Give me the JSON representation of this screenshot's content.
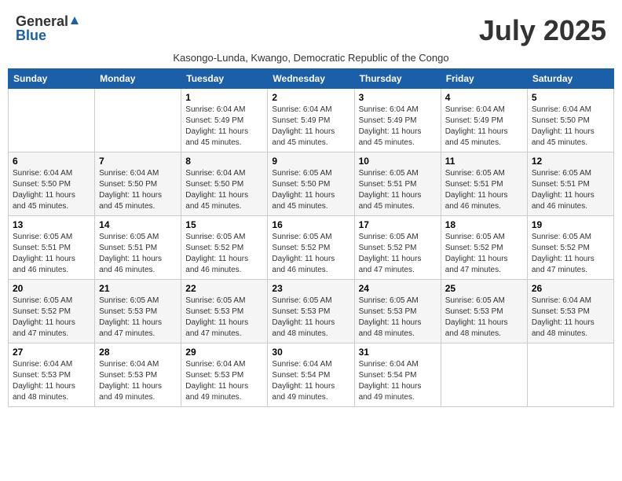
{
  "header": {
    "logo_general": "General",
    "logo_blue": "Blue",
    "month_title": "July 2025",
    "subtitle": "Kasongo-Lunda, Kwango, Democratic Republic of the Congo"
  },
  "days_of_week": [
    "Sunday",
    "Monday",
    "Tuesday",
    "Wednesday",
    "Thursday",
    "Friday",
    "Saturday"
  ],
  "weeks": [
    [
      {
        "day": "",
        "info": ""
      },
      {
        "day": "",
        "info": ""
      },
      {
        "day": "1",
        "info": "Sunrise: 6:04 AM\nSunset: 5:49 PM\nDaylight: 11 hours and 45 minutes."
      },
      {
        "day": "2",
        "info": "Sunrise: 6:04 AM\nSunset: 5:49 PM\nDaylight: 11 hours and 45 minutes."
      },
      {
        "day": "3",
        "info": "Sunrise: 6:04 AM\nSunset: 5:49 PM\nDaylight: 11 hours and 45 minutes."
      },
      {
        "day": "4",
        "info": "Sunrise: 6:04 AM\nSunset: 5:49 PM\nDaylight: 11 hours and 45 minutes."
      },
      {
        "day": "5",
        "info": "Sunrise: 6:04 AM\nSunset: 5:50 PM\nDaylight: 11 hours and 45 minutes."
      }
    ],
    [
      {
        "day": "6",
        "info": "Sunrise: 6:04 AM\nSunset: 5:50 PM\nDaylight: 11 hours and 45 minutes."
      },
      {
        "day": "7",
        "info": "Sunrise: 6:04 AM\nSunset: 5:50 PM\nDaylight: 11 hours and 45 minutes."
      },
      {
        "day": "8",
        "info": "Sunrise: 6:04 AM\nSunset: 5:50 PM\nDaylight: 11 hours and 45 minutes."
      },
      {
        "day": "9",
        "info": "Sunrise: 6:05 AM\nSunset: 5:50 PM\nDaylight: 11 hours and 45 minutes."
      },
      {
        "day": "10",
        "info": "Sunrise: 6:05 AM\nSunset: 5:51 PM\nDaylight: 11 hours and 45 minutes."
      },
      {
        "day": "11",
        "info": "Sunrise: 6:05 AM\nSunset: 5:51 PM\nDaylight: 11 hours and 46 minutes."
      },
      {
        "day": "12",
        "info": "Sunrise: 6:05 AM\nSunset: 5:51 PM\nDaylight: 11 hours and 46 minutes."
      }
    ],
    [
      {
        "day": "13",
        "info": "Sunrise: 6:05 AM\nSunset: 5:51 PM\nDaylight: 11 hours and 46 minutes."
      },
      {
        "day": "14",
        "info": "Sunrise: 6:05 AM\nSunset: 5:51 PM\nDaylight: 11 hours and 46 minutes."
      },
      {
        "day": "15",
        "info": "Sunrise: 6:05 AM\nSunset: 5:52 PM\nDaylight: 11 hours and 46 minutes."
      },
      {
        "day": "16",
        "info": "Sunrise: 6:05 AM\nSunset: 5:52 PM\nDaylight: 11 hours and 46 minutes."
      },
      {
        "day": "17",
        "info": "Sunrise: 6:05 AM\nSunset: 5:52 PM\nDaylight: 11 hours and 47 minutes."
      },
      {
        "day": "18",
        "info": "Sunrise: 6:05 AM\nSunset: 5:52 PM\nDaylight: 11 hours and 47 minutes."
      },
      {
        "day": "19",
        "info": "Sunrise: 6:05 AM\nSunset: 5:52 PM\nDaylight: 11 hours and 47 minutes."
      }
    ],
    [
      {
        "day": "20",
        "info": "Sunrise: 6:05 AM\nSunset: 5:52 PM\nDaylight: 11 hours and 47 minutes."
      },
      {
        "day": "21",
        "info": "Sunrise: 6:05 AM\nSunset: 5:53 PM\nDaylight: 11 hours and 47 minutes."
      },
      {
        "day": "22",
        "info": "Sunrise: 6:05 AM\nSunset: 5:53 PM\nDaylight: 11 hours and 47 minutes."
      },
      {
        "day": "23",
        "info": "Sunrise: 6:05 AM\nSunset: 5:53 PM\nDaylight: 11 hours and 48 minutes."
      },
      {
        "day": "24",
        "info": "Sunrise: 6:05 AM\nSunset: 5:53 PM\nDaylight: 11 hours and 48 minutes."
      },
      {
        "day": "25",
        "info": "Sunrise: 6:05 AM\nSunset: 5:53 PM\nDaylight: 11 hours and 48 minutes."
      },
      {
        "day": "26",
        "info": "Sunrise: 6:04 AM\nSunset: 5:53 PM\nDaylight: 11 hours and 48 minutes."
      }
    ],
    [
      {
        "day": "27",
        "info": "Sunrise: 6:04 AM\nSunset: 5:53 PM\nDaylight: 11 hours and 48 minutes."
      },
      {
        "day": "28",
        "info": "Sunrise: 6:04 AM\nSunset: 5:53 PM\nDaylight: 11 hours and 49 minutes."
      },
      {
        "day": "29",
        "info": "Sunrise: 6:04 AM\nSunset: 5:53 PM\nDaylight: 11 hours and 49 minutes."
      },
      {
        "day": "30",
        "info": "Sunrise: 6:04 AM\nSunset: 5:54 PM\nDaylight: 11 hours and 49 minutes."
      },
      {
        "day": "31",
        "info": "Sunrise: 6:04 AM\nSunset: 5:54 PM\nDaylight: 11 hours and 49 minutes."
      },
      {
        "day": "",
        "info": ""
      },
      {
        "day": "",
        "info": ""
      }
    ]
  ]
}
